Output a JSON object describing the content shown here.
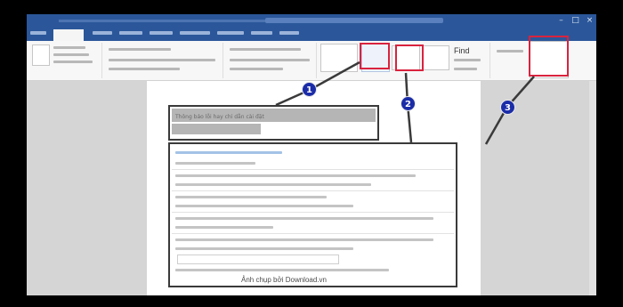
{
  "callout_text": "Thông báo lỗi hay chỉ dẫn cài đặt",
  "panel_caption": "Ảnh chụp bởi Download.vn",
  "steps": [
    "1",
    "2",
    "3"
  ],
  "ribbon_label": "Find",
  "colors": {
    "title_bar": "#2b579a",
    "annotation_red": "#d9233e",
    "badge_blue": "#1b2ca8",
    "arrow": "#3a3a3a"
  },
  "icons": [
    "close-icon",
    "minimize-icon",
    "restore-icon"
  ]
}
